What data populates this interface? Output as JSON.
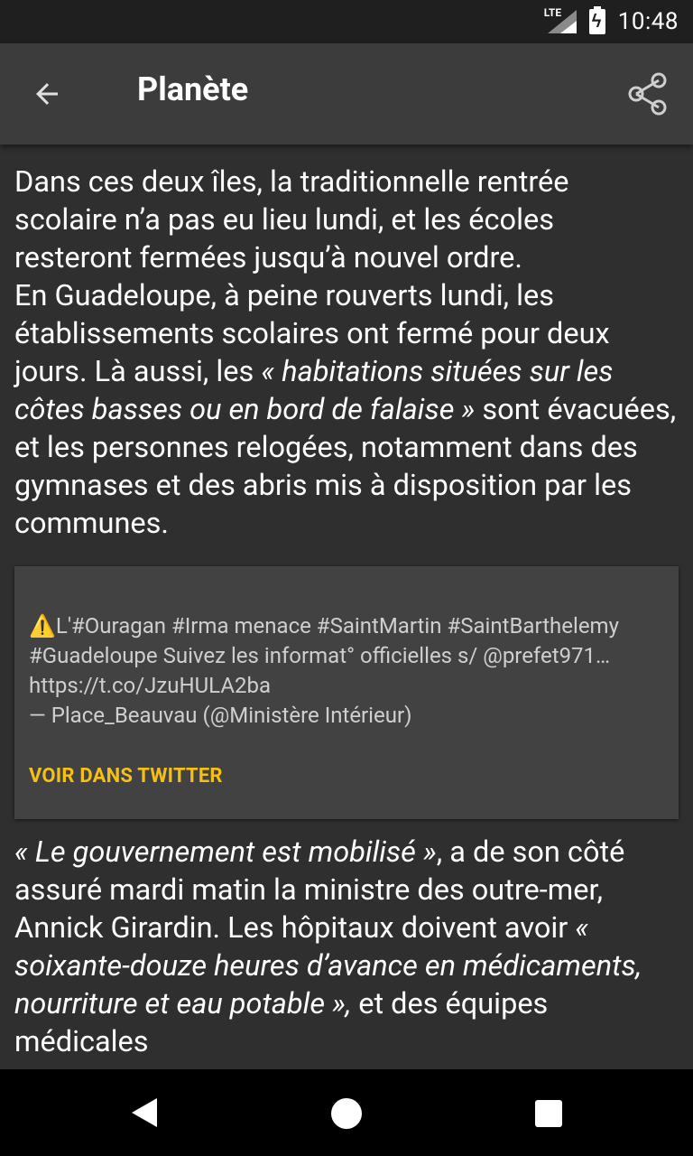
{
  "status_bar": {
    "network": "LTE",
    "time": "10:48"
  },
  "app_bar": {
    "title": "Planète"
  },
  "article": {
    "para1_a": "Dans ces deux îles, la traditionnelle rentrée scolaire n’a pas eu lieu lundi, et les écoles resteront fermées jusqu’à nouvel ordre.",
    "para1_b": "En Guadeloupe, à peine rouverts lundi, les établissements scolaires ont fermé pour deux jours. Là aussi, les ",
    "para1_quote": "« habitations situées sur les côtes basses ou en bord de falaise »",
    "para1_c": " sont évacuées, et les personnes relogées, notamment dans des gymnases et des abris mis à disposition par les communes.",
    "para2_quote1": "« Le gouvernement est mobilisé »",
    "para2_a": ", a de son côté assuré mardi matin la ministre des outre-mer, Annick Girardin. Les hôpitaux doivent avoir ",
    "para2_quote2": "« soixante-douze heures d’avance en médicaments, nourriture et eau potable »,",
    "para2_b": " et des équipes médicales"
  },
  "tweet": {
    "warning_glyph": "⚠️",
    "text": "L'#Ouragan #Irma menace #SaintMartin #SaintBarthelemy #Guadeloupe Suivez les informat° officielles s/ @prefet971… https://t.co/JzuHULA2ba",
    "attribution": "— Place_Beauvau (@Ministère Intérieur)",
    "link_label": "VOIR DANS TWITTER"
  },
  "colors": {
    "accent": "#f5c016",
    "background": "#2f2f2f",
    "app_bar": "#3c3c3c",
    "card": "#424242"
  },
  "icons": {
    "back": "arrow-left-icon",
    "share": "share-icon",
    "nav_back": "triangle-back-icon",
    "nav_home": "circle-home-icon",
    "nav_recent": "square-recents-icon"
  }
}
